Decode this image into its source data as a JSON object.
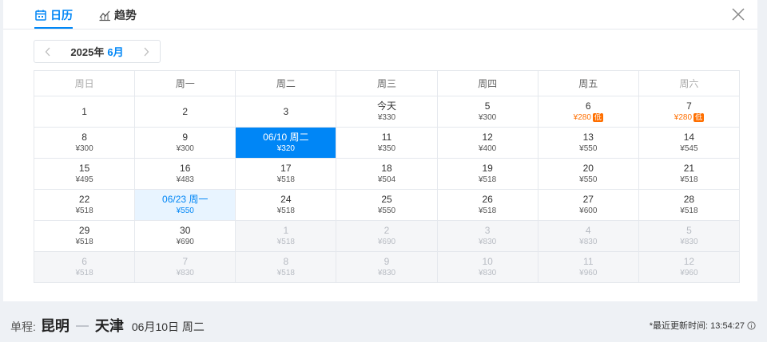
{
  "tabs": [
    {
      "label": "日历",
      "icon": "calendar-icon",
      "active": true
    },
    {
      "label": "趋势",
      "icon": "trend-chart-icon",
      "active": false
    }
  ],
  "month_nav": {
    "year": "2025年",
    "month": "6月"
  },
  "weekdays": [
    "周日",
    "周一",
    "周二",
    "周三",
    "周四",
    "周五",
    "周六"
  ],
  "weeks": [
    [
      {
        "day": "1",
        "price": "",
        "state": "normal"
      },
      {
        "day": "2",
        "price": "",
        "state": "normal"
      },
      {
        "day": "3",
        "price": "",
        "state": "normal"
      },
      {
        "day": "今天",
        "price": "¥330",
        "state": "normal"
      },
      {
        "day": "5",
        "price": "¥300",
        "state": "normal"
      },
      {
        "day": "6",
        "price": "¥280",
        "state": "low",
        "badge": "低"
      },
      {
        "day": "7",
        "price": "¥280",
        "state": "low",
        "badge": "低"
      }
    ],
    [
      {
        "day": "8",
        "price": "¥300",
        "state": "normal"
      },
      {
        "day": "9",
        "price": "¥300",
        "state": "normal"
      },
      {
        "day": "06/10 周二",
        "price": "¥320",
        "state": "selected"
      },
      {
        "day": "11",
        "price": "¥350",
        "state": "normal"
      },
      {
        "day": "12",
        "price": "¥400",
        "state": "normal"
      },
      {
        "day": "13",
        "price": "¥550",
        "state": "normal"
      },
      {
        "day": "14",
        "price": "¥545",
        "state": "normal"
      }
    ],
    [
      {
        "day": "15",
        "price": "¥495",
        "state": "normal"
      },
      {
        "day": "16",
        "price": "¥483",
        "state": "normal"
      },
      {
        "day": "17",
        "price": "¥518",
        "state": "normal"
      },
      {
        "day": "18",
        "price": "¥504",
        "state": "normal"
      },
      {
        "day": "19",
        "price": "¥518",
        "state": "normal"
      },
      {
        "day": "20",
        "price": "¥550",
        "state": "normal"
      },
      {
        "day": "21",
        "price": "¥518",
        "state": "normal"
      }
    ],
    [
      {
        "day": "22",
        "price": "¥518",
        "state": "normal"
      },
      {
        "day": "06/23 周一",
        "price": "¥550",
        "state": "return"
      },
      {
        "day": "24",
        "price": "¥518",
        "state": "normal"
      },
      {
        "day": "25",
        "price": "¥550",
        "state": "normal"
      },
      {
        "day": "26",
        "price": "¥518",
        "state": "normal"
      },
      {
        "day": "27",
        "price": "¥600",
        "state": "normal"
      },
      {
        "day": "28",
        "price": "¥518",
        "state": "normal"
      }
    ],
    [
      {
        "day": "29",
        "price": "¥518",
        "state": "normal"
      },
      {
        "day": "30",
        "price": "¥690",
        "state": "normal"
      },
      {
        "day": "1",
        "price": "¥518",
        "state": "other"
      },
      {
        "day": "2",
        "price": "¥690",
        "state": "other"
      },
      {
        "day": "3",
        "price": "¥830",
        "state": "other"
      },
      {
        "day": "4",
        "price": "¥830",
        "state": "other"
      },
      {
        "day": "5",
        "price": "¥830",
        "state": "other"
      }
    ],
    [
      {
        "day": "6",
        "price": "¥518",
        "state": "other"
      },
      {
        "day": "7",
        "price": "¥830",
        "state": "other"
      },
      {
        "day": "8",
        "price": "¥518",
        "state": "other"
      },
      {
        "day": "9",
        "price": "¥830",
        "state": "other"
      },
      {
        "day": "10",
        "price": "¥830",
        "state": "other"
      },
      {
        "day": "11",
        "price": "¥960",
        "state": "other"
      },
      {
        "day": "12",
        "price": "¥960",
        "state": "other"
      }
    ]
  ],
  "footer": {
    "trip_type": "单程:",
    "from_city": "昆明",
    "to_city": "天津",
    "date": "06月10日 周二",
    "update_text": "*最近更新时间: 13:54:27"
  },
  "colors": {
    "accent": "#0086f6",
    "low_price": "#ff6f00"
  }
}
